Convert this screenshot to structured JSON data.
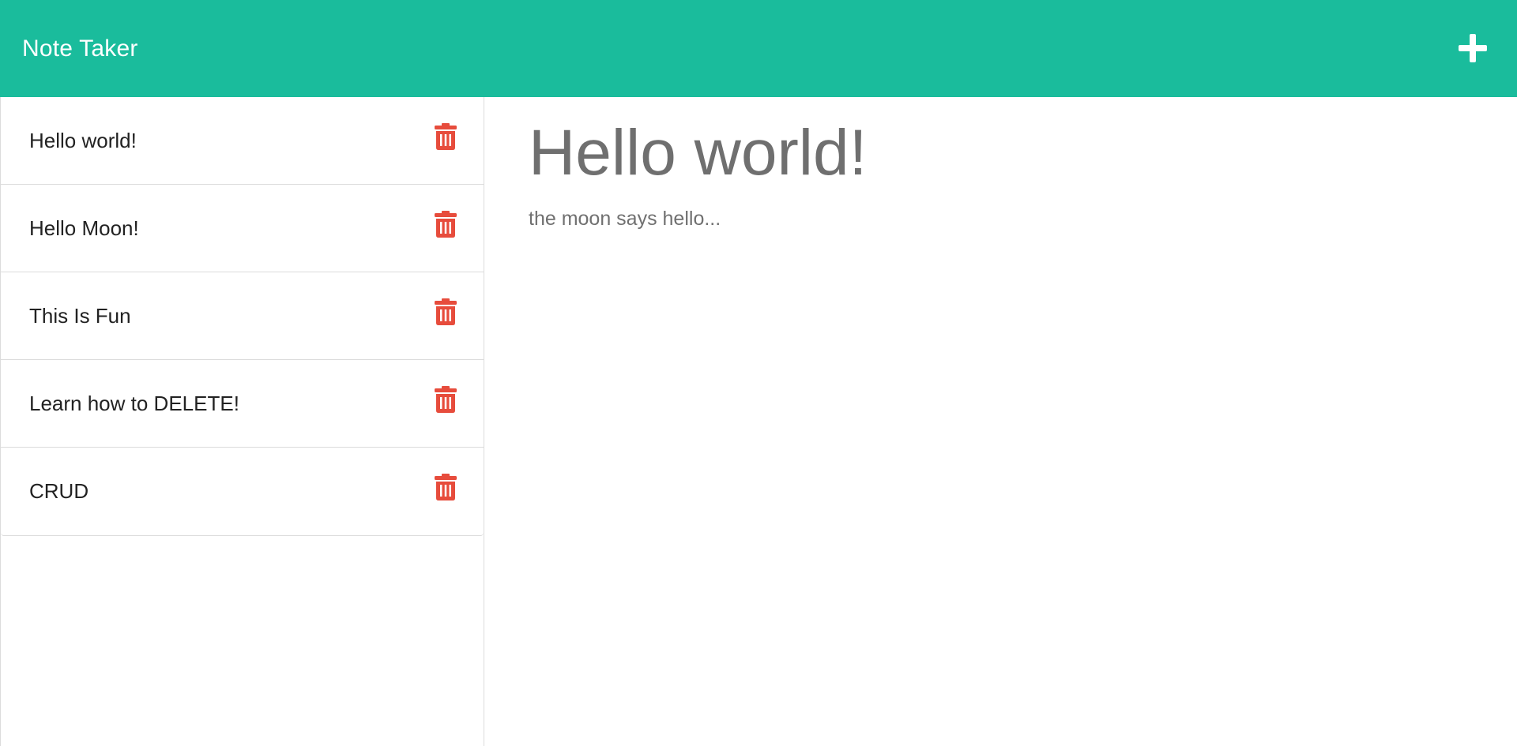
{
  "app": {
    "brand": "Note Taker",
    "new_note_icon": "plus-icon",
    "colors": {
      "navbar": "#1abc9c",
      "delete": "#e74c3c",
      "note_text": "#222222",
      "display_text": "#707070"
    }
  },
  "sidebar": {
    "notes": [
      {
        "title": "Hello world!",
        "icon": "trash-icon"
      },
      {
        "title": "Hello Moon!",
        "icon": "trash-icon"
      },
      {
        "title": "This Is Fun",
        "icon": "trash-icon"
      },
      {
        "title": "Learn how to DELETE!",
        "icon": "trash-icon"
      },
      {
        "title": "CRUD",
        "icon": "trash-icon"
      }
    ]
  },
  "main": {
    "title": "Hello world!",
    "text": "the moon says hello..."
  }
}
